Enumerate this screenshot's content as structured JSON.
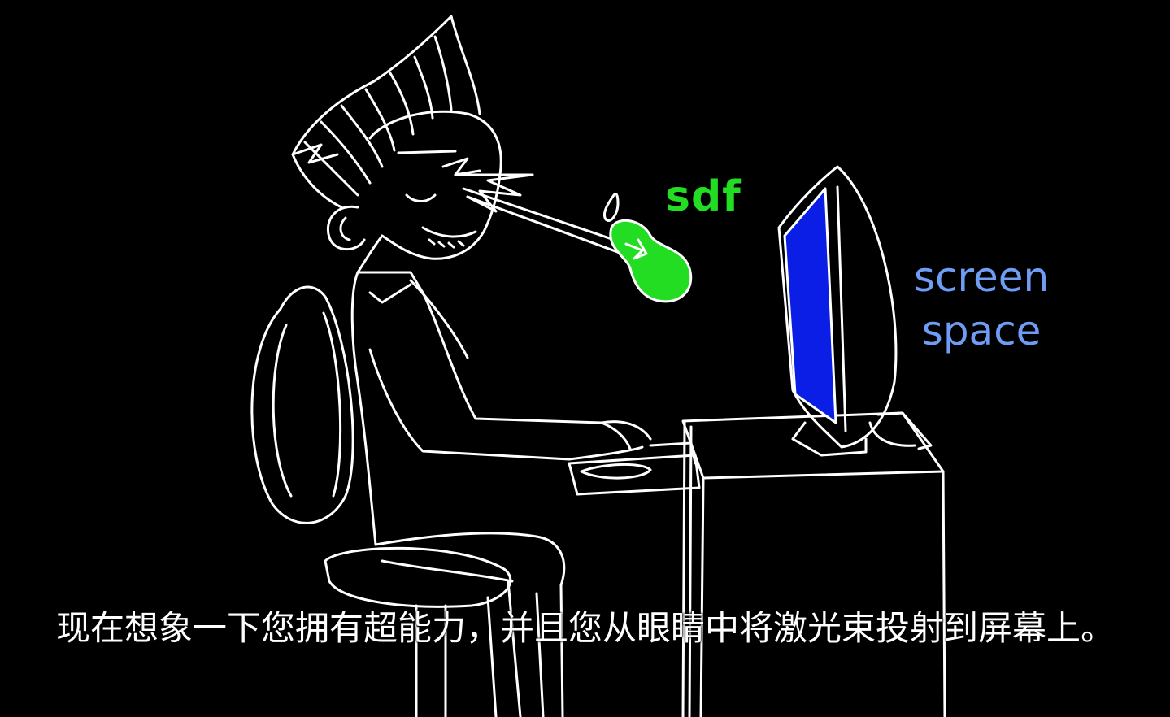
{
  "scene": {
    "background": "#000000",
    "line_color": "#ffffff",
    "sdf_color": "#22dd22",
    "screen_color": "#0a1ee6",
    "label_color_screen_space": "#6f9cf5"
  },
  "labels": {
    "sdf": "sdf",
    "screen_space_line1": "screen",
    "screen_space_line2": "space"
  },
  "subtitle": {
    "text": "现在想象一下您拥有超能力，并且您从眼睛中将激光束投射到屏幕上。"
  },
  "icons": {
    "person": "person-at-computer-illustration",
    "monitor": "crt-monitor-icon",
    "blob": "sdf-blob-icon",
    "laser": "laser-beam-icon"
  }
}
